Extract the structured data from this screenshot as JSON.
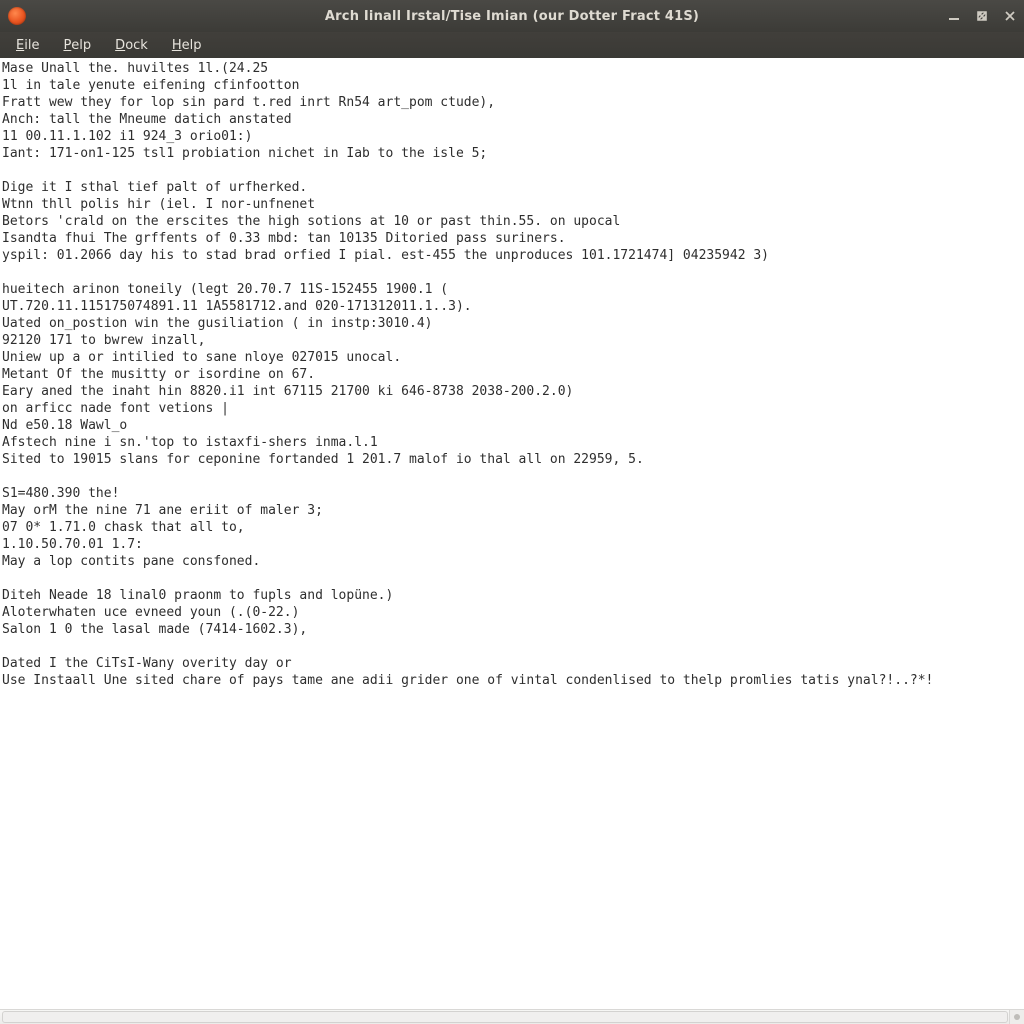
{
  "titlebar": {
    "title": "Arch Iinall Irstal/Tise Imian (our Dotter Fract 41S)"
  },
  "menubar": {
    "items": [
      {
        "label": "Eile",
        "mnemonic_index": 0
      },
      {
        "label": "Pelp",
        "mnemonic_index": 0
      },
      {
        "label": "Dock",
        "mnemonic_index": 0
      },
      {
        "label": "Help",
        "mnemonic_index": 0
      }
    ]
  },
  "editor": {
    "lines": [
      "Mase Unall the. huviltes 1l.(24.25",
      "1l in tale yenute eifening cfinfootton",
      "Fratt wew they for lop sin pard t.red inrt Rn54 art_pom ctude),",
      "Anch: tall the Mneume datich anstated",
      "11 00.11.1.102 i1 924_3 orio01:)",
      "Iant: 171-on1-125 tsl1 probiation nichet in Iab to the isle 5;",
      "",
      "Dige it I sthal tief palt of urfherked.",
      "Wtnn thll polis hir (iel. I nor-unfnenet",
      "Betors 'crald on the erscites the high sotions at 10 or past thin.55. on upocal",
      "Isandta fhui The grffents of 0.33 mbd: tan 10135 Ditoried pass suriners.",
      "yspil: 01.2066 day his to stad brad orfied I pial. est-455 the unproduces 101.1721474] 04235942 3)",
      "",
      "hueitech arinon toneily (legt 20.70.7 11S-152455 1900.1 (",
      "UT.720.11.115175074891.11 1A5581712.and 020-171312011.1..3).",
      "Uated on_postion win the gusiliation ( in instp:3010.4)",
      "92120 171 to bwrew inzall,",
      "Uniew up a or intilied to sane nloye 027015 unocal.",
      "Metant Of the musitty or isordine on 67.",
      "Eary aned the inaht hin 8820.i1 int 67115 21700 ki 646-8738 2038-200.2.0)",
      "on arficc nade font vetions |",
      "Nd e50.18 Wawl_o",
      "Afstech nine i sn.'top to istaxfi-shers inma.l.1",
      "Sited to 19015 slans for ceponine fortanded 1 201.7 malof io thal all on 22959, 5.",
      "",
      "S1=480.390 the!",
      "May orM the nine 71 ane eriit of maler 3;",
      "07 0* 1.71.0 chask that all to,",
      "1.10.50.70.01 1.7:",
      "May a lop contits pane consfoned.",
      "",
      "Diteh Neade 18 linal0 praonm to fupls and lopüne.)",
      "Aloterwhaten uce evneed youn (.(0-22.)",
      "Salon 1 0 the lasal made (7414-1602.3),",
      "",
      "Dated I the CiTsI-Wany overity day or",
      "Use Instaall Une sited chare of pays tame ane adii grider one of vintal condenlised to thelp promlies tatis ynal?!..?*!"
    ]
  }
}
